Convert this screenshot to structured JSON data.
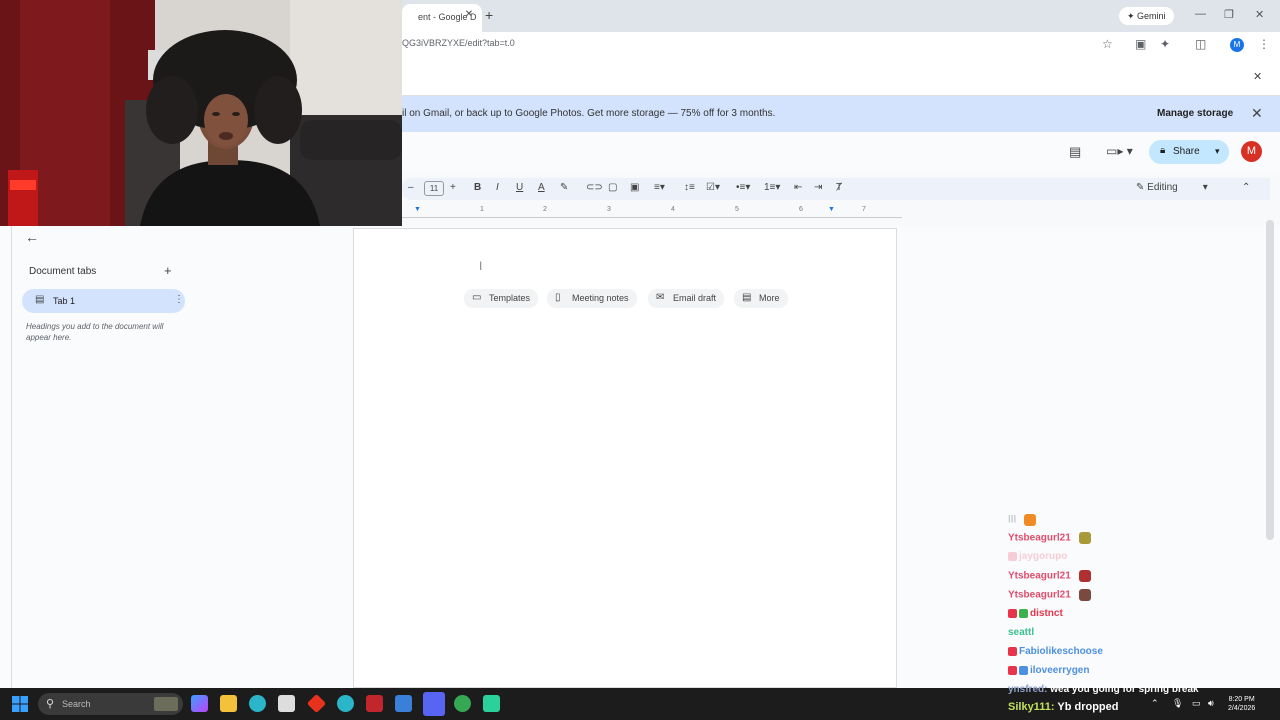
{
  "browser": {
    "tab_title": "ent - Google D",
    "tab_close": "✕",
    "new_tab": "+",
    "gemini_label": "Gemini",
    "url": "QG3iVBRZYXE/edit?tab=t.0",
    "minimize": "—",
    "restore": "❐",
    "close": "✕",
    "account_initial": "M"
  },
  "banner": {
    "message": "il on Gmail, or back up to Google Photos. Get more storage — 75% off for 3 months.",
    "manage_label": "Manage storage",
    "close": "✕"
  },
  "header": {
    "share_label": "Share",
    "avatar_initial": "M"
  },
  "toolbar": {
    "font_size": "11",
    "mode_label": "Editing"
  },
  "ruler": {
    "ticks": [
      "1",
      "2",
      "3",
      "4",
      "5",
      "6",
      "7"
    ]
  },
  "outline": {
    "title": "Document tabs",
    "tab_label": "Tab 1",
    "hint": "Headings you add to the document will appear here."
  },
  "page": {
    "chips": [
      {
        "label": "Templates",
        "icon": "templates-icon"
      },
      {
        "label": "Meeting notes",
        "icon": "meeting-notes-icon"
      },
      {
        "label": "Email draft",
        "icon": "email-draft-icon"
      },
      {
        "label": "More",
        "icon": "more-icon"
      }
    ]
  },
  "chat": {
    "messages": [
      {
        "user": "lll",
        "text": "",
        "color": "#cccccc"
      },
      {
        "user": "Ytsbeagurl21",
        "text": "",
        "color": "#e24c6b"
      },
      {
        "user": "jaygorupo",
        "text": "",
        "color": "#f4a0b0"
      },
      {
        "user": "Ytsbeagurl21",
        "text": "",
        "color": "#e24c6b"
      },
      {
        "user": "Ytsbeagurl21",
        "text": "",
        "color": "#e24c6b"
      },
      {
        "user": "distnct",
        "text": "",
        "color": "#e8344a"
      },
      {
        "user": "seattl",
        "text": "",
        "color": "#3cbf8f"
      },
      {
        "user": "Fabiolikeschoose",
        "text": "",
        "color": "#4d8fe0"
      },
      {
        "user": "iloveerrygen",
        "text": "",
        "color": "#4d8fe0"
      },
      {
        "user": "ynsfred:",
        "text": "wea you going for spring break",
        "color": "#8fa0c8"
      },
      {
        "user": "Silky111:",
        "text": "Yb dropped",
        "color": "#c0e05a"
      }
    ]
  },
  "taskbar": {
    "search_label": "Search",
    "time": "8:20 PM",
    "date": "2/4/2026"
  }
}
